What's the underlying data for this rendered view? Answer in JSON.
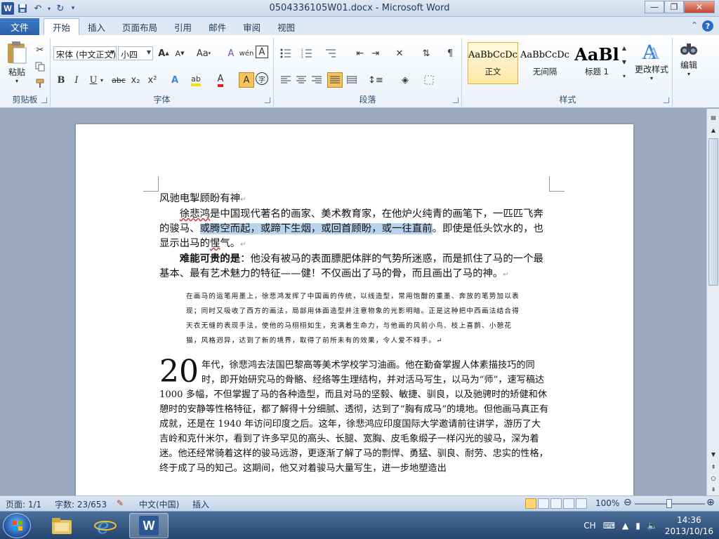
{
  "window": {
    "title": "0504336105W01.docx - Microsoft Word",
    "app_icon_letter": "W"
  },
  "quick_access": {
    "save": "💾",
    "undo": "↶",
    "redo": "↻"
  },
  "window_controls": {
    "minimize": "—",
    "restore": "❐",
    "close": "✕"
  },
  "tabs": {
    "file": "文件",
    "items": [
      "开始",
      "插入",
      "页面布局",
      "引用",
      "邮件",
      "审阅",
      "视图"
    ],
    "active_index": 0
  },
  "ribbon": {
    "clipboard": {
      "label": "剪贴板",
      "paste": "粘贴"
    },
    "font": {
      "label": "字体",
      "font_name": "宋体 (中文正文)",
      "font_size": "小四",
      "grow": "A",
      "shrink": "A",
      "change_case": "Aa",
      "clear_format": "A",
      "phonetic": "wén",
      "char_border": "A",
      "bold": "B",
      "italic": "I",
      "underline": "U",
      "strikethrough": "abc",
      "subscript": "x₂",
      "superscript": "x²",
      "text_effects": "A",
      "highlight": "ab",
      "font_color": "A",
      "char_shading": "A",
      "enclose": "字"
    },
    "paragraph": {
      "label": "段落"
    },
    "styles": {
      "label": "样式",
      "items": [
        {
          "sample": "AaBbCcDc",
          "name": "正文"
        },
        {
          "sample": "AaBbCcDc",
          "name": "无间隔"
        },
        {
          "sample": "AaBl",
          "name": "标题 1"
        }
      ],
      "change_styles": "更改样式"
    },
    "editing": {
      "label": "编辑"
    }
  },
  "document": {
    "title_line": "风驰电掣顾盼有神",
    "para1_name": "徐悲鸿",
    "para1_a": "是中国现代著名的画家、美术教育家，在他炉火纯青的画笔下，一匹匹飞奔的骏马、",
    "para1_highlight": "或腾空而起，或蹄下生烟，或回首顾盼，或一往直前",
    "para1_b": "。即使是低头饮水的，也显示出马的",
    "para1_c": "惺",
    "para1_d": "气。",
    "para2_bold": "难能可贵的是",
    "para2_rest": "：他没有被马的表面膘肥体胖的气势所迷惑，而是抓住了马的一个最基本、最有艺术魅力的特征——健！不仅画出了马的骨，而且画出了马的神。",
    "quote": "在画马的运笔用墨上，徐悲鸿发挥了中国画的传统，以线造型，常用饱酣的重墨、奔放的笔势加以表现；同时又吸收了西方的画法，局部用体面造型并注意物象的光影明暗。正是这种把中西画法结合得天衣无缝的表现手法，使他的马栩栩如生，充满着生命力，与他画的风前小鸟、枝上喜鹊、小憩花猫，风格迥异，达到了新的境界，取得了前所未有的效果，令人爱不释手。",
    "dropcap": "20",
    "para3": "年代，徐悲鸿去法国巴黎高等美术学校学习油画。他在勤奋掌握人体素描技巧的同时，即开始研究马的骨骼、经络等生理结构，并对活马写生，以马为“师”，速写稿达 1000 多幅，不但掌握了马的各种造型，而且对马的坚毅、敏捷、驯良，以及驰骋时的矫健和休憩时的安静等性格特征，都了解得十分细腻、透彻，达到了“胸有成马”的境地。但他画马真正有成就，还是在 1940 年访问印度之后。这年，徐悲鸿应印度国际大学邀请前往讲学，游历了大吉岭和克什米尔，看到了许多罕见的高头、长腿、宽胸、皮毛象缎子一样闪光的骏马，深为着迷。他还经常骑着这样的骏马远游，更逐渐了解了马的剽悍、勇猛、驯良、耐劳、忠实的性格，终于成了马的知己。这期间，他又对着骏马大量写生，进一步地塑造出"
  },
  "statusbar": {
    "page": "页面: 1/1",
    "words": "字数: 23/653",
    "language": "中文(中国)",
    "mode": "插入",
    "zoom": "100%",
    "zoom_level": 100
  },
  "taskbar": {
    "ime": "CH",
    "time": "14:36",
    "date": "2013/10/16"
  }
}
